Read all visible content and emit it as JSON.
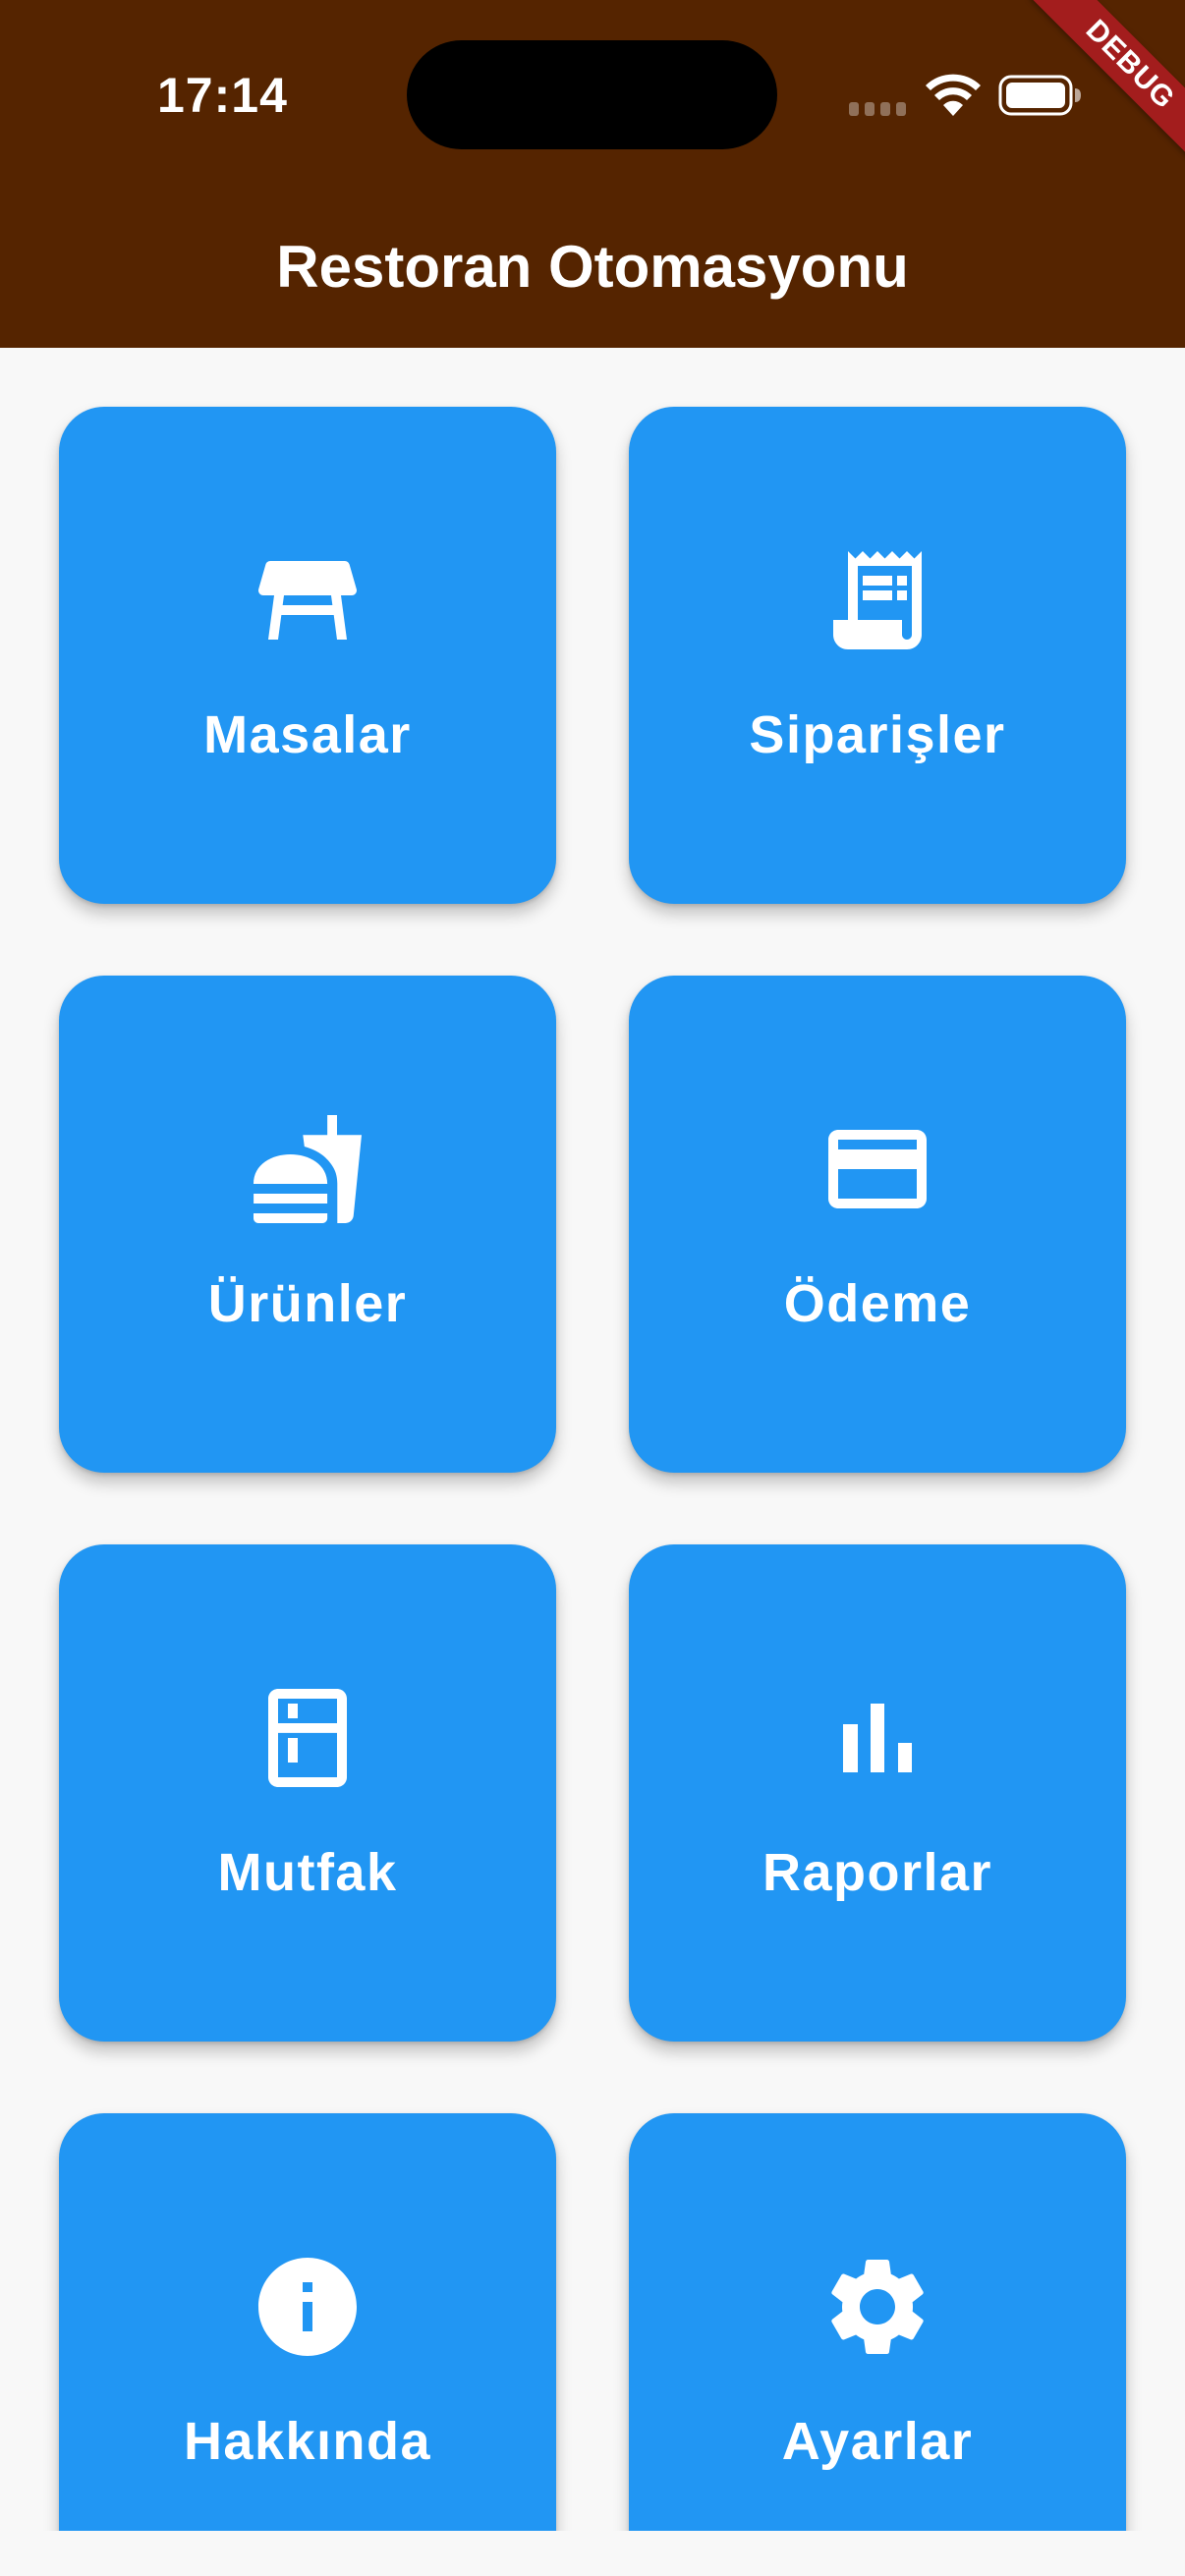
{
  "status_bar": {
    "time": "17:14"
  },
  "app_bar": {
    "title": "Restoran Otomasyonu",
    "debug_banner": "DEBUG"
  },
  "colors": {
    "app_bar_background": "#552400",
    "tile_background": "#2196f3",
    "page_background": "#f8f8f8",
    "debug_banner": "#a31d1d",
    "text_on_color": "#ffffff"
  },
  "menu": {
    "items": [
      {
        "label": "Masalar",
        "icon": "table-restaurant-icon"
      },
      {
        "label": "Siparişler",
        "icon": "receipt-long-icon"
      },
      {
        "label": "Ürünler",
        "icon": "fastfood-icon"
      },
      {
        "label": "Ödeme",
        "icon": "credit-card-icon"
      },
      {
        "label": "Mutfak",
        "icon": "kitchen-icon"
      },
      {
        "label": "Raporlar",
        "icon": "bar-chart-icon"
      },
      {
        "label": "Hakkında",
        "icon": "info-icon"
      },
      {
        "label": "Ayarlar",
        "icon": "settings-gear-icon"
      }
    ]
  }
}
